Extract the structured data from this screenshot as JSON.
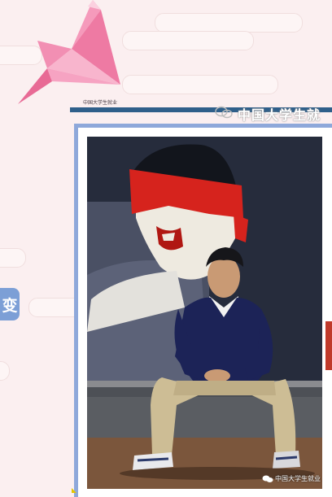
{
  "header": {
    "small_caption": "中国大学生就业",
    "watermark": "中国大学生就"
  },
  "side_badge": {
    "label": "变"
  },
  "photo": {
    "watermark": "中国大学生就业"
  },
  "icons": {
    "crane": "origami-crane-icon",
    "wechat": "wechat-icon"
  },
  "colors": {
    "background": "#fbeff0",
    "divider": "#2f5f8a",
    "frame": "#8ea8da",
    "badge": "#7c9fd6"
  }
}
